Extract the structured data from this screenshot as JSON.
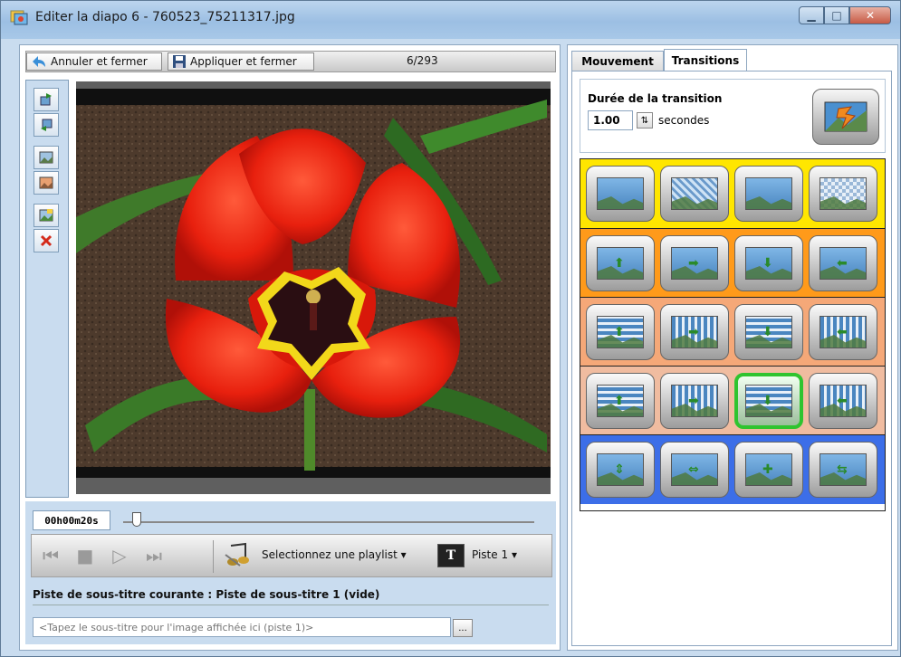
{
  "window": {
    "title": "Editer la diapo 6 - 760523_75211317.jpg"
  },
  "toolbar": {
    "cancel_label": "Annuler et fermer",
    "apply_label": "Appliquer et fermer",
    "counter": "6/293"
  },
  "timeline": {
    "time": "00h00m20s",
    "playlist_label": "Selectionnez une playlist",
    "track_label": "Piste 1"
  },
  "subtitles": {
    "heading": "Piste de sous-titre courante : Piste de sous-titre 1 (vide)",
    "placeholder": "<Tapez le sous-titre pour l'image affichée ici (piste 1)>",
    "browse_label": "..."
  },
  "tabs": {
    "movement": "Mouvement",
    "transitions": "Transitions"
  },
  "transition": {
    "duration_title": "Durée de la transition",
    "duration_value": "1.00",
    "unit": "secondes"
  },
  "groups": [
    {
      "color": "#ffe600",
      "tiles": [
        "fade-icon",
        "dissolve-icon",
        "blur-icon",
        "checker-icon"
      ]
    },
    {
      "color": "#ff9a1a",
      "tiles": [
        "slide-up-icon",
        "slide-right-icon",
        "slide-down-icon",
        "slide-left-icon"
      ]
    },
    {
      "color": "#f5a878",
      "tiles": [
        "stripes-up-icon",
        "bars-right-icon",
        "stripes-down-icon",
        "bars-left-icon"
      ]
    },
    {
      "color": "#f0bca0",
      "tiles": [
        "wipe-up-icon",
        "wipe-right-icon",
        "wipe-down-icon",
        "wipe-left-icon"
      ]
    },
    {
      "color": "#3c6ee8",
      "tiles": [
        "split-vertical-icon",
        "split-horizontal-icon",
        "cross-in-icon",
        "split-in-icon"
      ]
    }
  ],
  "selected_tile": "wipe-down-icon"
}
